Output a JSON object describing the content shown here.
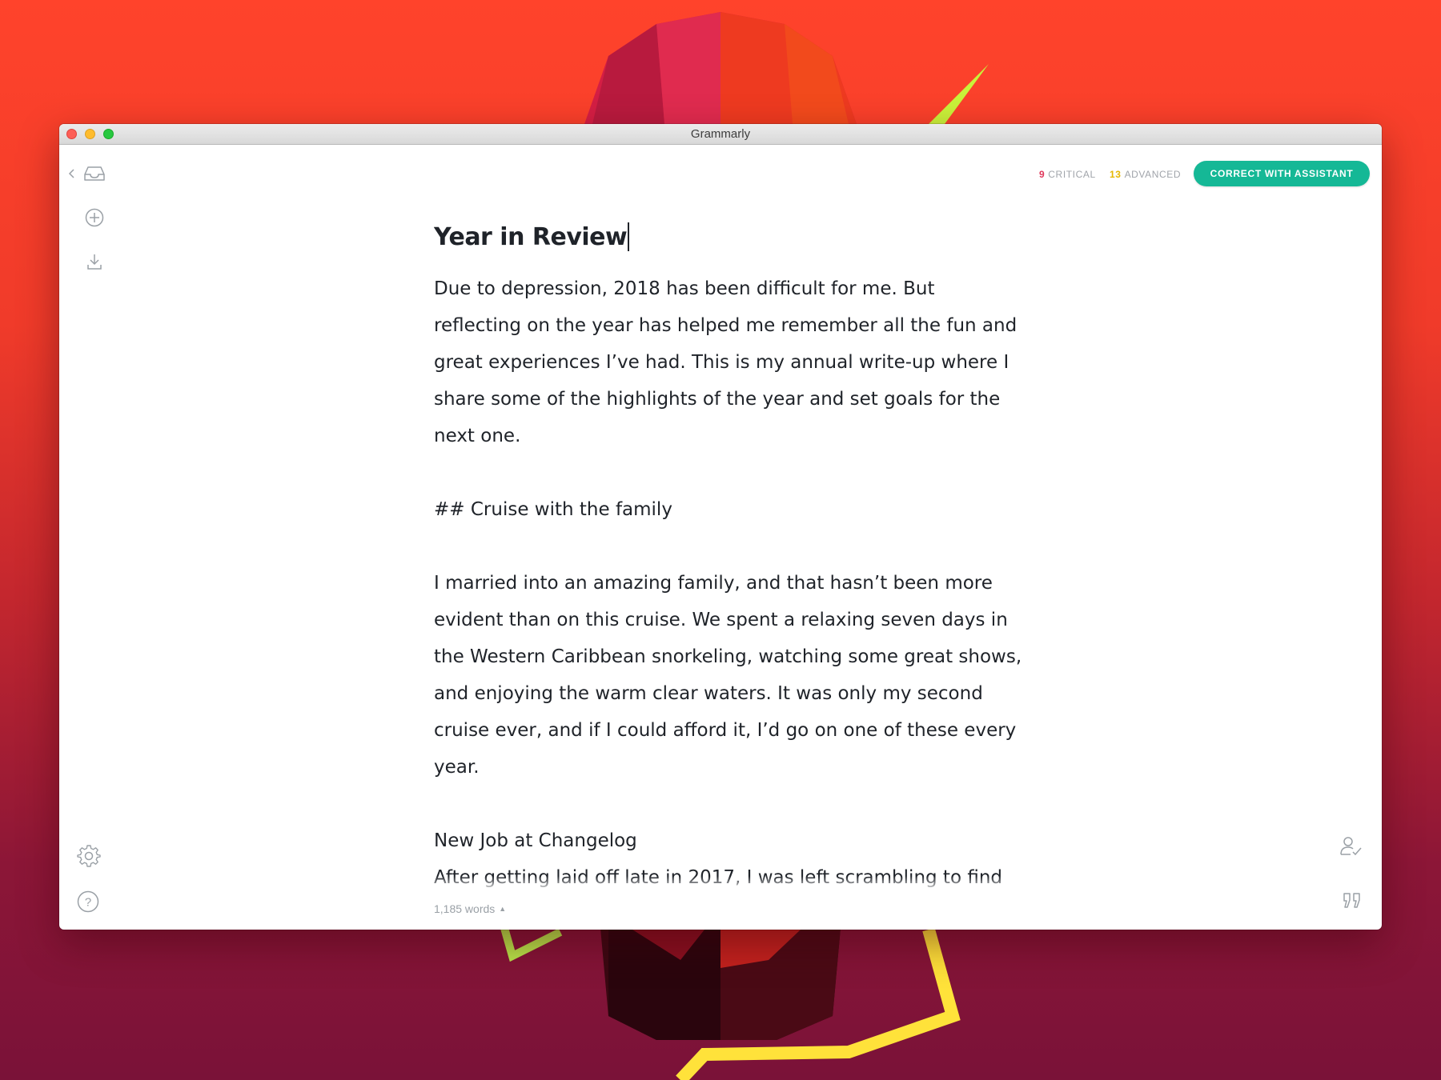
{
  "window": {
    "title": "Grammarly"
  },
  "toolbar": {
    "critical_count": "9",
    "critical_label": "CRITICAL",
    "advanced_count": "13",
    "advanced_label": "ADVANCED",
    "assistant_button": "CORRECT WITH ASSISTANT"
  },
  "sidebar": {
    "icons": [
      "back-icon",
      "inbox-icon",
      "add-icon",
      "download-icon",
      "settings-icon",
      "help-icon"
    ]
  },
  "document": {
    "title": "Year in Review",
    "paragraphs": [
      "Due to depression, 2018 has been difficult for me. But reflecting on the year has helped me remember all the fun and great experiences I’ve had. This is my annual write-up where I share some of the highlights of the year and set goals for the next one.",
      "## Cruise with the family",
      "I married into an amazing family, and that hasn’t been more evident than on this cruise. We spent a relaxing seven days in the Western Caribbean snorkeling, watching some great shows, and enjoying the warm clear waters. It was only my second cruise ever, and if I could afford it, I’d go on one of these every year.",
      "New Job at Changelog",
      "After getting laid off late in 2017, I was left scrambling to find"
    ]
  },
  "footer": {
    "word_count": "1,185 words"
  },
  "right_icons": [
    "user-check-icon",
    "quote-icon"
  ],
  "colors": {
    "accent": "#15b896",
    "critical": "#e0385b",
    "advanced": "#e6b800",
    "background_top": "#ff432b",
    "background_bottom": "#7a1238"
  }
}
